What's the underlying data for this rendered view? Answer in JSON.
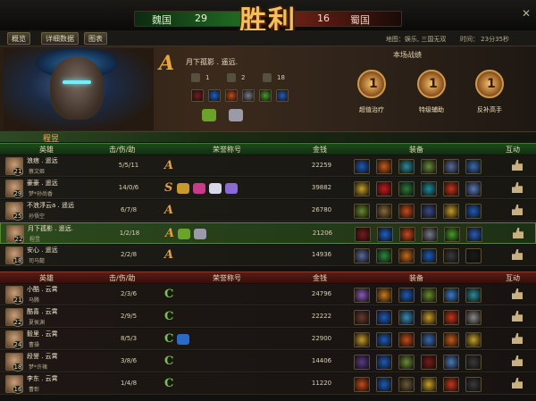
{
  "score": {
    "left_team": "魏国",
    "left_score": "29",
    "victory": "胜利",
    "right_score": "16",
    "right_team": "蜀国"
  },
  "tabs": [
    "概览",
    "详细数据",
    "图表"
  ],
  "match": {
    "map_label": "地图：娱乐, 三国无双",
    "time_label": "时间：  23分35秒"
  },
  "player": {
    "grade": "A",
    "name": "月下孤影 . 遥远.",
    "stats": [
      {
        "icon": "sword-icon",
        "value": "1"
      },
      {
        "icon": "crossed-axes-icon",
        "value": "2"
      },
      {
        "icon": "skull-icon",
        "value": "18"
      }
    ],
    "items": [
      "#7a1a1a",
      "#1c5fc8",
      "#c84a1a",
      "#7a7a8a",
      "#4a9a2a",
      "#2a5ab8"
    ],
    "badges": [
      "#6aa22a",
      "#9a9aa8"
    ]
  },
  "honors": {
    "title": "本场战绩",
    "items": [
      "超值治疗",
      "特级辅助",
      "反补高手"
    ]
  },
  "hero_name": "程昱",
  "headers": {
    "hero": "英雄",
    "kda": "击/伤/助",
    "honor": "荣誉称号",
    "gold": "金钱",
    "equip": "装备",
    "interact": "互动"
  },
  "team_green": [
    {
      "name": "浪痞 . 遥远",
      "level": "21",
      "hero": "蔡文姬",
      "kda": "5/5/11",
      "grade": "A",
      "badges": [],
      "gold": "22259",
      "equip": [
        "#1e5ab8",
        "#c85a1a",
        "#2a8a9a",
        "#6a8a3a",
        "#5a6a9a",
        "#3a6ab0"
      ]
    },
    {
      "name": "豪豪 . 遥远",
      "level": "29",
      "hero": "梦*孙尚香",
      "kda": "14/0/6",
      "grade": "S",
      "badges": [
        "#c89a2a",
        "#c83a8a",
        "#d8d8e8",
        "#8a6ad8"
      ],
      "gold": "39882",
      "equip": [
        "#c8a02a",
        "#c81a1a",
        "#2a7a3a",
        "#1e8a9a",
        "#c8341a",
        "#5a7ab8"
      ]
    },
    {
      "name": "不浪浮云a . 遥远",
      "level": "25",
      "hero": "孙悟空",
      "kda": "6/7/8",
      "grade": "A",
      "badges": [],
      "gold": "26780",
      "equip": [
        "#6a8a2a",
        "#8a6a3a",
        "#c84a1a",
        "#3a4a8a",
        "#c89a2a",
        "#1e5ab8"
      ]
    },
    {
      "name": "月下孤影 . 遥远.",
      "level": "22",
      "hero": "程昱",
      "kda": "1/2/18",
      "grade": "A",
      "badges": [
        "#6aa22a",
        "#9a9aa8"
      ],
      "gold": "21206",
      "equip": [
        "#7a1a1a",
        "#1c5fc8",
        "#c84a1a",
        "#7a7a8a",
        "#4a9a2a",
        "#2a5ab8"
      ]
    },
    {
      "name": "安心 . 遥远",
      "level": "18",
      "hero": "司马懿",
      "kda": "2/2/8",
      "grade": "A",
      "badges": [],
      "gold": "14936",
      "equip": [
        "#5a6a9a",
        "#2a8a3a",
        "#c86a1a",
        "#1e5ab8",
        "#3a3a3a",
        "#1a1a1a"
      ]
    }
  ],
  "team_red": [
    {
      "name": "小酷 . 云霄",
      "level": "21",
      "hero": "马腾",
      "kda": "2/3/6",
      "grade": "C",
      "badges": [],
      "gold": "24796",
      "equip": [
        "#8a5ab8",
        "#c87a1a",
        "#1e5ab8",
        "#6a8a2a",
        "#3a7ac8",
        "#2a8a9a"
      ]
    },
    {
      "name": "酷喜 . 云霄",
      "level": "22",
      "hero": "夏侯渊",
      "kda": "2/9/5",
      "grade": "C",
      "badges": [],
      "gold": "22222",
      "equip": [
        "#6a3a2a",
        "#1e5ab8",
        "#3a8ab8",
        "#c89a2a",
        "#c8341a",
        "#8a8a8a"
      ]
    },
    {
      "name": "毅里 . 云霄",
      "level": "24",
      "hero": "曹操",
      "kda": "8/5/3",
      "grade": "C",
      "badges": [
        "#2a6ac8"
      ],
      "gold": "22900",
      "equip": [
        "#c89a2a",
        "#1e5ab8",
        "#c84a1a",
        "#3a6ab0",
        "#c85a1a",
        "#c8a02a"
      ]
    },
    {
      "name": "段誉 . 云霄",
      "level": "18",
      "hero": "梦*许褚",
      "kda": "3/8/6",
      "grade": "C",
      "badges": [],
      "gold": "14406",
      "equip": [
        "#5a3a8a",
        "#1e5ab8",
        "#6a8a3a",
        "#7a1a1a",
        "#4a7ab8",
        "#3a3a3a"
      ]
    },
    {
      "name": "李东 . 云霄",
      "level": "16",
      "hero": "曹彰",
      "kda": "1/4/8",
      "grade": "C",
      "badges": [],
      "gold": "11220",
      "equip": [
        "#c84a1a",
        "#1e5ab8",
        "#6a5a3a",
        "#c8a02a",
        "#c8341a",
        "#3a3a3a"
      ]
    }
  ]
}
